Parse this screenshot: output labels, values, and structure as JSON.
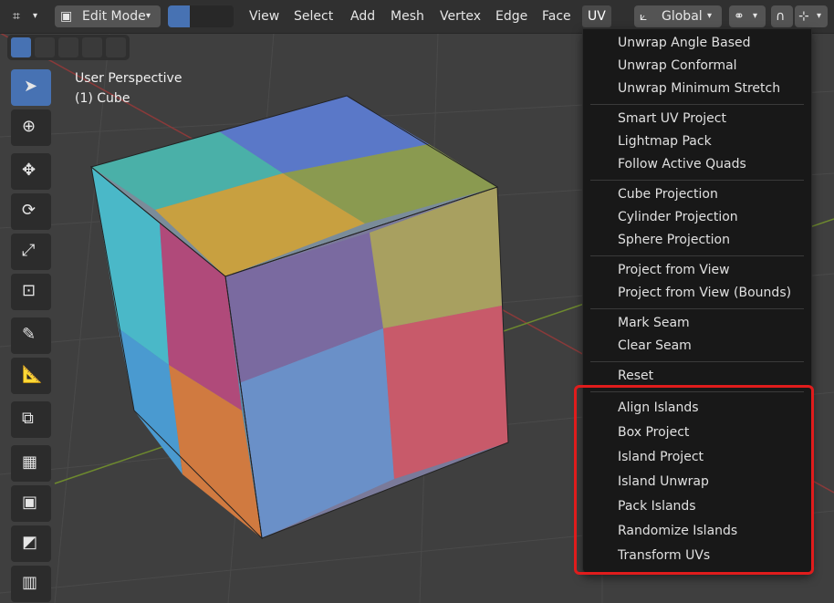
{
  "header": {
    "mode_label": "Edit Mode",
    "menus": [
      "View",
      "Select",
      "Add",
      "Mesh",
      "Vertex",
      "Edge",
      "Face",
      "UV"
    ],
    "transform_orientation": "Global"
  },
  "overlay": {
    "perspective": "User Perspective",
    "object": "(1) Cube"
  },
  "uv_menu": {
    "groups": [
      [
        "Unwrap Angle Based",
        "Unwrap Conformal",
        "Unwrap Minimum Stretch"
      ],
      [
        "Smart UV Project",
        "Lightmap Pack",
        "Follow Active Quads"
      ],
      [
        "Cube Projection",
        "Cylinder Projection",
        "Sphere Projection"
      ],
      [
        "Project from View",
        "Project from View (Bounds)"
      ],
      [
        "Mark Seam",
        "Clear Seam"
      ],
      [
        "Reset"
      ],
      [
        "Align Islands",
        "Box Project",
        "Island Project",
        "Island Unwrap",
        "Pack Islands",
        "Randomize Islands",
        "Transform UVs"
      ]
    ]
  },
  "colors": {
    "accent": "#4772b3",
    "highlight": "#e01c1c"
  }
}
